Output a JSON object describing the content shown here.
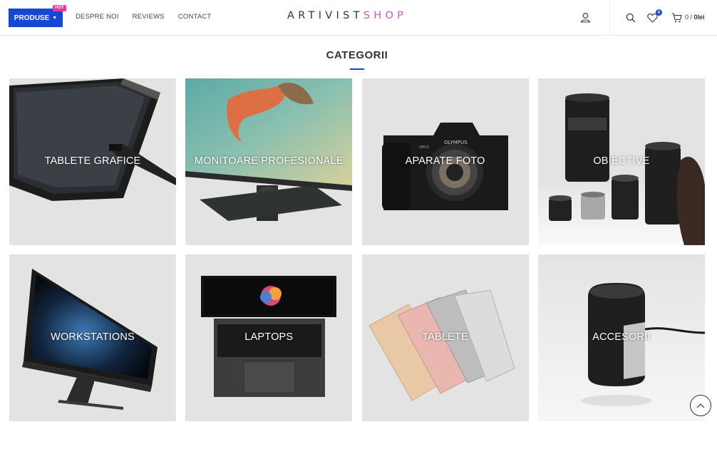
{
  "header": {
    "produse_label": "PRODUSE",
    "hot_badge": "HOT",
    "nav": [
      "DESPRE NOI",
      "REVIEWS",
      "CONTACT"
    ],
    "logo_part1": "ARTIVIST",
    "logo_part2": "SHOP",
    "wishlist_count": "0",
    "cart_count": "0",
    "cart_total": "0lei",
    "cart_separator": " / ",
    "icons": [
      "user-icon",
      "search-icon",
      "heart-icon",
      "cart-icon"
    ]
  },
  "section": {
    "title": "CATEGORII"
  },
  "categories": [
    {
      "label": "TABLETE GRAFICE",
      "image": "graphics-tablet"
    },
    {
      "label": "MONITOARE PROFESIONALE",
      "image": "pro-monitor"
    },
    {
      "label": "APARATE FOTO",
      "image": "camera"
    },
    {
      "label": "OBIECTIVE",
      "image": "lenses"
    },
    {
      "label": "WORKSTATIONS",
      "image": "imac-pro"
    },
    {
      "label": "LAPTOPS",
      "image": "macbook"
    },
    {
      "label": "TABLETE",
      "image": "ipads"
    },
    {
      "label": "ACCESORII",
      "image": "colorimeter"
    }
  ],
  "image_text": {
    "camera_brand": "OLYMPUS",
    "camera_model": "OM-D"
  },
  "colors": {
    "accent": "#1547d4",
    "hot": "#e8399b",
    "logo_shop": "#c45bc8",
    "card_bg": "#e3e3e3"
  }
}
